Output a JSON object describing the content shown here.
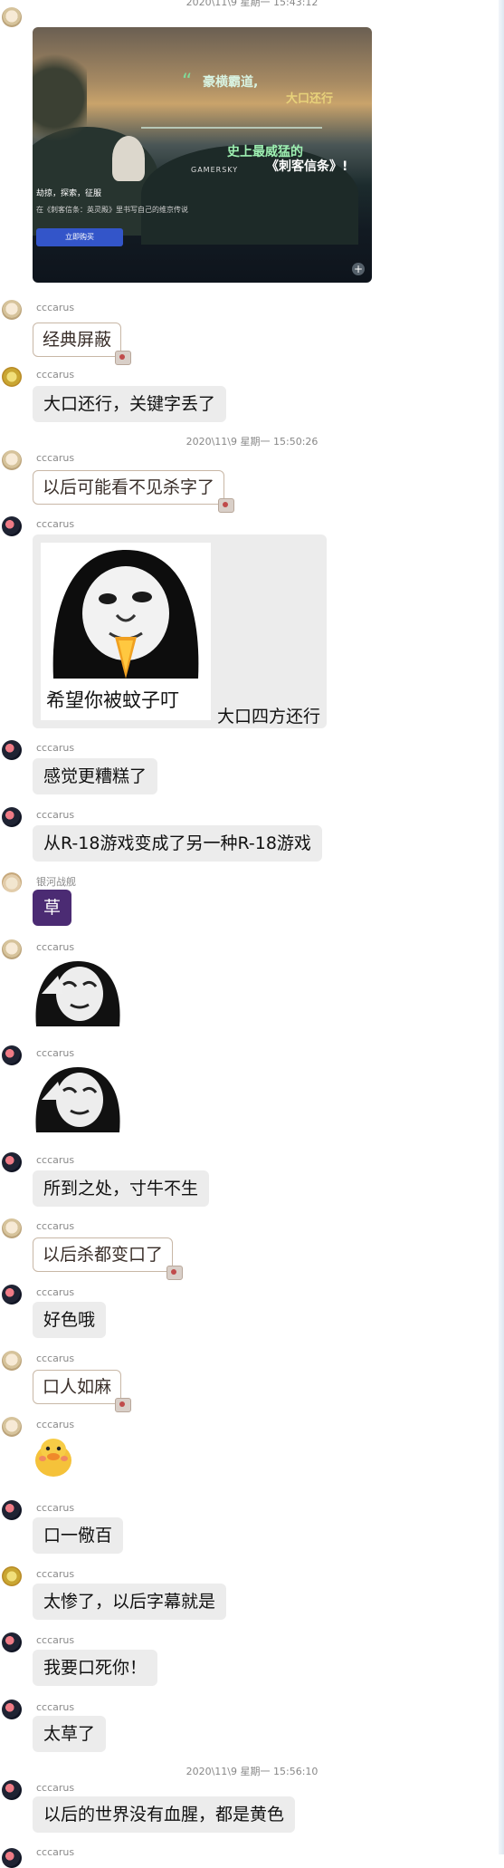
{
  "timestamps": {
    "t1": "2020\\11\\9 星期一 15:43:12",
    "t2": "2020\\11\\9 星期一 15:50:26",
    "t3": "2020\\11\\9 星期一 15:56:10"
  },
  "game": {
    "quote_mark": "“",
    "line1": "豪横霸道,",
    "line2": "大口还行",
    "line3": "史上最威猛的",
    "line4": "《刺客信条》!",
    "watermark": "GAMERSKY",
    "caption1": "劫掠，探索，征服",
    "caption2": "在《刺客信条：英灵殿》里书写自己的维京传说",
    "button": "立即购买",
    "plus": "+"
  },
  "messages": [
    {
      "name": "cccarus",
      "text": "经典屏蔽"
    },
    {
      "name": "cccarus",
      "text": "大口还行，关键字丢了"
    },
    {
      "name": "cccarus",
      "text": "以后可能看不见杀字了"
    },
    {
      "name": "cccarus",
      "meme_caption": "希望你被蚊子叮",
      "side_text": "大口四方还行"
    },
    {
      "name": "cccarus",
      "text": "感觉更糟糕了"
    },
    {
      "name": "cccarus",
      "text": "从R-18游戏变成了另一种R-18游戏"
    },
    {
      "name": "银河战舰",
      "text": "草"
    },
    {
      "name": "cccarus"
    },
    {
      "name": "cccarus"
    },
    {
      "name": "cccarus",
      "text": "所到之处，寸牛不生"
    },
    {
      "name": "cccarus",
      "text": "以后杀都变口了"
    },
    {
      "name": "cccarus",
      "text": "好色哦"
    },
    {
      "name": "cccarus",
      "text": "口人如麻"
    },
    {
      "name": "cccarus"
    },
    {
      "name": "cccarus",
      "text": "口一儆百"
    },
    {
      "name": "cccarus",
      "text": "太惨了，以后字幕就是"
    },
    {
      "name": "cccarus",
      "text": "我要口死你！"
    },
    {
      "name": "cccarus",
      "text": "太草了"
    },
    {
      "name": "cccarus",
      "text": "以后的世界没有血腥，都是黄色"
    },
    {
      "name": "cccarus"
    }
  ]
}
